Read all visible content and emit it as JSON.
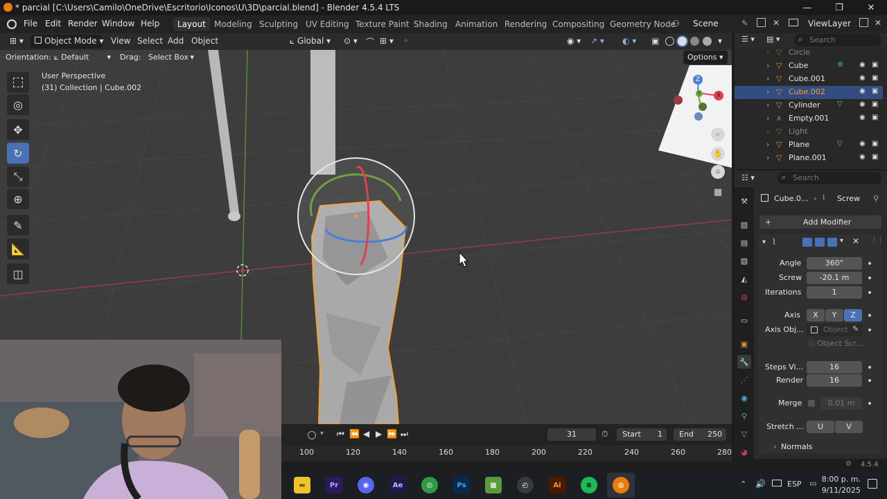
{
  "window": {
    "title": "* parcial [C:\\Users\\Camilo\\OneDrive\\Escritorio\\Iconos\\U\\3D\\parcial.blend] - Blender 4.5.4 LTS",
    "minimize": "—",
    "maximize": "❐",
    "close": "✕"
  },
  "menu": {
    "file": "File",
    "edit": "Edit",
    "render": "Render",
    "window": "Window",
    "help": "Help"
  },
  "workspaces": [
    "Layout",
    "Modeling",
    "Sculpting",
    "UV Editing",
    "Texture Paint",
    "Shading",
    "Animation",
    "Rendering",
    "Compositing",
    "Geometry Node"
  ],
  "scene": {
    "label": "Scene"
  },
  "viewlayer": {
    "label": "ViewLayer"
  },
  "viewport_header": {
    "mode": "Object Mode",
    "view": "View",
    "select": "Select",
    "add": "Add",
    "object": "Object",
    "transform": "Global"
  },
  "toolsettings": {
    "orientation_label": "Orientation:",
    "orientation_value": "Default",
    "drag_label": "Drag:",
    "drag_value": "Select Box",
    "options": "Options"
  },
  "viewport": {
    "perspective": "User Perspective",
    "collection": "(31) Collection | Cube.002",
    "gizmo_x": "X",
    "gizmo_y": "Y",
    "gizmo_z": "Z"
  },
  "outliner": {
    "search_placeholder": "Search",
    "rows": [
      {
        "name": "Circle",
        "dim": true
      },
      {
        "name": "Cube",
        "dim": false
      },
      {
        "name": "Cube.001",
        "dim": false
      },
      {
        "name": "Cube.002",
        "dim": false,
        "selected": true
      },
      {
        "name": "Cylinder",
        "dim": false
      },
      {
        "name": "Empty.001",
        "dim": false
      },
      {
        "name": "Light",
        "dim": true
      },
      {
        "name": "Plane",
        "dim": false
      },
      {
        "name": "Plane.001",
        "dim": false
      }
    ]
  },
  "properties": {
    "search_placeholder": "Search",
    "breadcrumb_object": "Cube.0...",
    "breadcrumb_modifier": "Screw",
    "add_modifier": "Add Modifier",
    "angle_label": "Angle",
    "angle_value": "360°",
    "screw_label": "Screw",
    "screw_value": "-20.1 m",
    "iterations_label": "Iterations",
    "iterations_value": "1",
    "axis_label": "Axis",
    "axis_x": "X",
    "axis_y": "Y",
    "axis_z": "Z",
    "axis_obj_label": "Axis Obj...",
    "axis_obj_placeholder": "Object",
    "object_screw": "Object Scr...",
    "steps_viewport_label": "Steps Vi...",
    "steps_viewport_value": "16",
    "render_label": "Render",
    "render_value": "16",
    "merge_label": "Merge",
    "merge_value": "0.01 m",
    "stretch_label": "Stretch ...",
    "stretch_u": "U",
    "stretch_v": "V",
    "normals": "Normals"
  },
  "timeline": {
    "current_frame": "31",
    "start_label": "Start",
    "start_value": "1",
    "end_label": "End",
    "end_value": "250",
    "ticks": [
      "100",
      "120",
      "140",
      "160",
      "180",
      "200",
      "220",
      "240",
      "260",
      "280"
    ]
  },
  "status": {
    "version": "4.5.4"
  },
  "taskbar": {
    "apps": [
      {
        "name": "file-explorer",
        "glyph": "▬",
        "color": "#f2c12e"
      },
      {
        "name": "premiere",
        "glyph": "Pr",
        "color": "#2a1a5e"
      },
      {
        "name": "discord",
        "glyph": "◉",
        "color": "#5865f2"
      },
      {
        "name": "after-effects",
        "glyph": "Ae",
        "color": "#1f1a4d"
      },
      {
        "name": "chrome",
        "glyph": "◎",
        "color": "#2e9a47"
      },
      {
        "name": "photoshop",
        "glyph": "Ps",
        "color": "#0b2a4a"
      },
      {
        "name": "minecraft",
        "glyph": "▦",
        "color": "#5b9a3c"
      },
      {
        "name": "recorder",
        "glyph": "◴",
        "color": "#3a3a3a"
      },
      {
        "name": "illustrator",
        "glyph": "Ai",
        "color": "#4a1a00"
      },
      {
        "name": "spotify",
        "glyph": "≋",
        "color": "#1db954"
      },
      {
        "name": "blender",
        "glyph": "◍",
        "color": "#e87d0d"
      }
    ],
    "lang": "ESP",
    "time": "8:00 p. m.",
    "date": "9/11/2025"
  },
  "colors": {
    "accent": "#4772b3",
    "selection_orange": "#f0a030",
    "x_axis": "#e0404f",
    "y_axis": "#6ea33e",
    "z_axis": "#4a7fd8"
  }
}
